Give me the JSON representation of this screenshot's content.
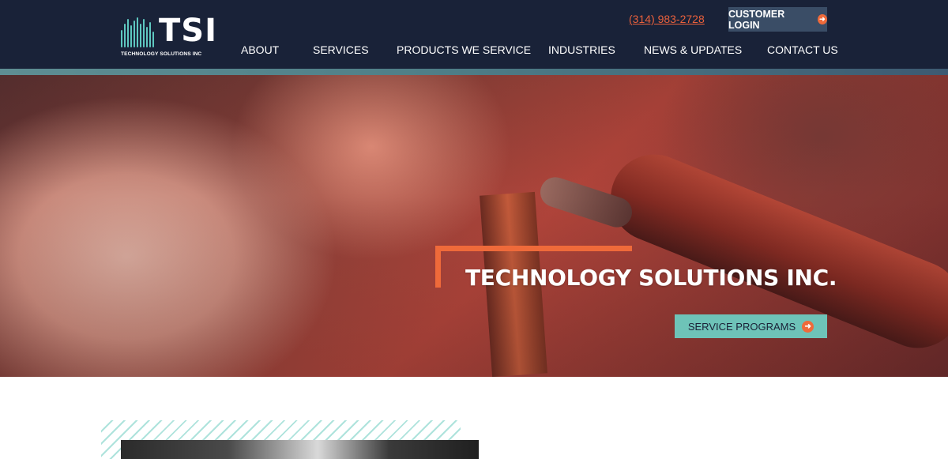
{
  "brand": {
    "logo_text": "TSI",
    "logo_subtitle": "TECHNOLOGY SOLUTIONS INC",
    "accent_color": "#ef6a3a",
    "teal_color": "#6ec3b8",
    "navy_color": "#192238"
  },
  "header": {
    "phone": "(314) 983-2728",
    "login_label": "CUSTOMER LOGIN",
    "login_icon": "arrow-right-circle-icon"
  },
  "nav": {
    "items": [
      {
        "label": "ABOUT"
      },
      {
        "label": "SERVICES"
      },
      {
        "label": "PRODUCTS WE SERVICE"
      },
      {
        "label": "INDUSTRIES"
      },
      {
        "label": "NEWS & UPDATES"
      },
      {
        "label": "CONTACT US"
      }
    ]
  },
  "hero": {
    "title": "TECHNOLOGY SOLUTIONS INC.",
    "cta_label": "SERVICE PROGRAMS",
    "cta_icon": "arrow-right-circle-icon",
    "image": "soldering-iron-photo"
  },
  "content": {
    "media": "video-thumbnail"
  }
}
